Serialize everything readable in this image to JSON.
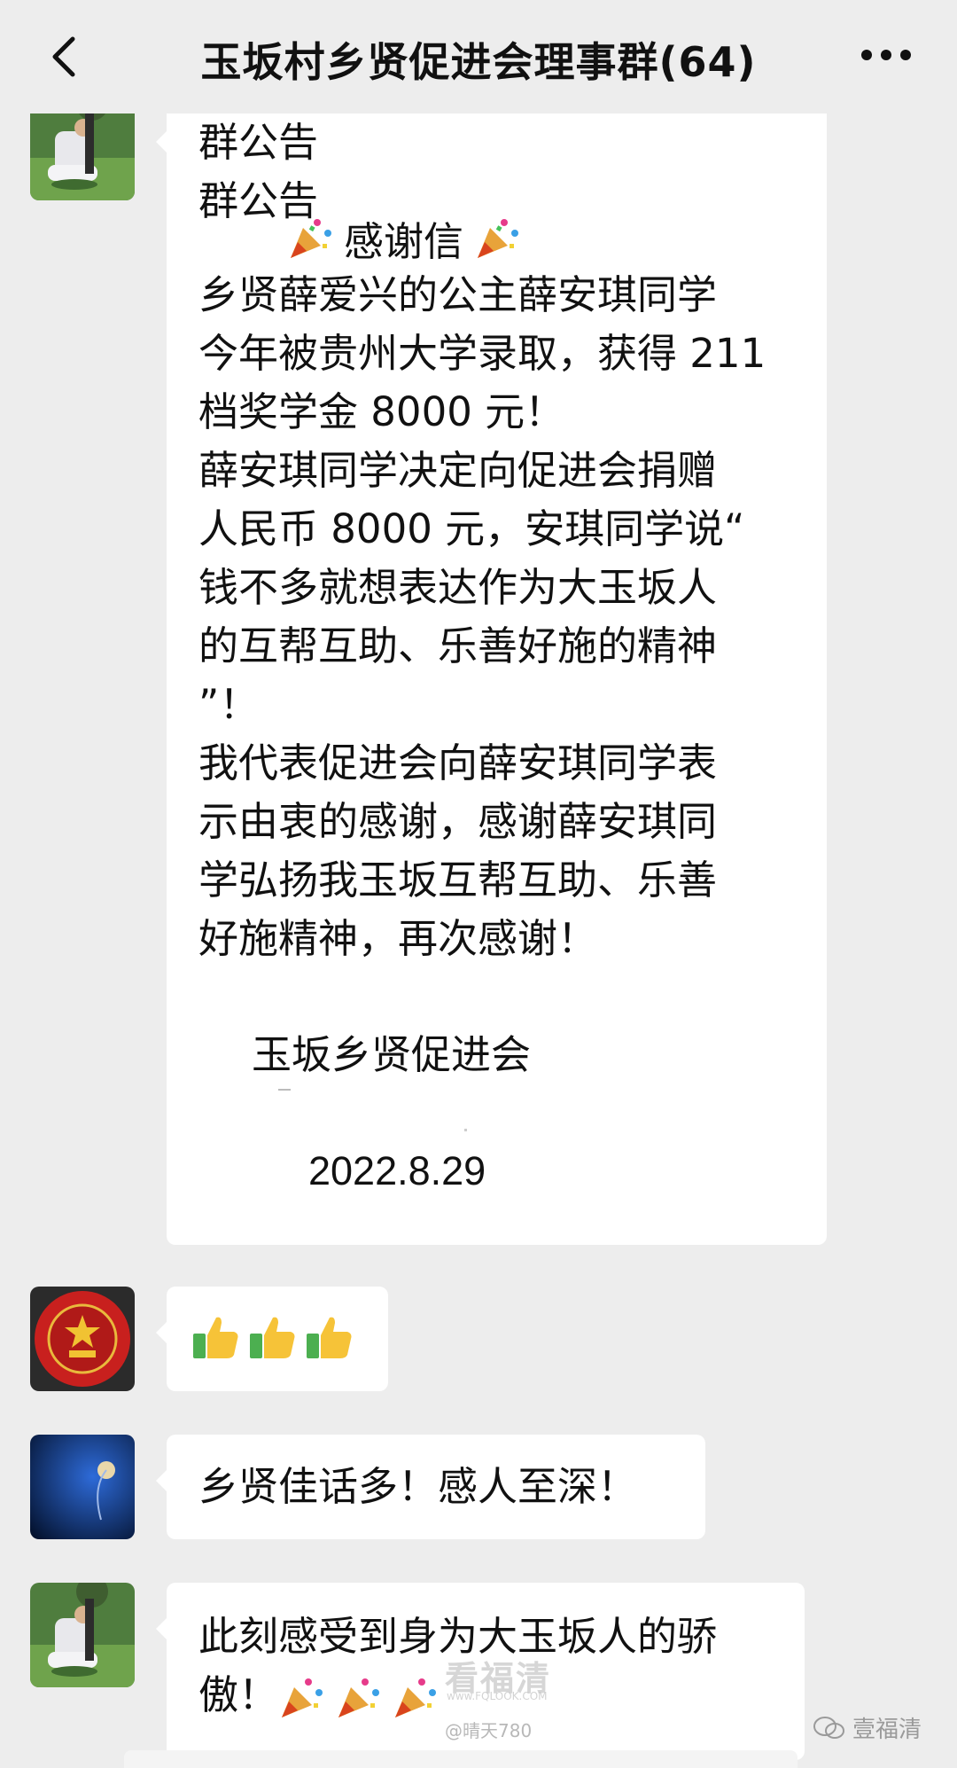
{
  "header": {
    "title": "玉坂村乡贤促进会理事群(64)",
    "back_icon": "chevron-left-icon",
    "more_icon": "more-dots-icon"
  },
  "messages": {
    "notice": {
      "lines_head": "群公告\n群公告",
      "letter_title": "感谢信",
      "body": "乡贤薛爱兴的公主薛安琪同学\n今年被贵州大学录取，获得 211\n档奖学金 8000 元！\n薛安琪同学决定向促进会捐赠\n人民币 8000 元，安琪同学说“\n钱不多就想表达作为大玉坂人\n的互帮互助、乐善好施的精神\n”！\n我代表促进会向薛安琪同学表\n示由衷的感谢，感谢薛安琪同\n学弘扬我玉坂互帮互助、乐善\n好施精神，再次感谢！",
      "org": "玉坂乡贤促进会",
      "date": "2022.8.29"
    },
    "thumbs": {
      "emoji": "thumbs-up-icon"
    },
    "msg3": {
      "text": "乡贤佳话多！感人至深！"
    },
    "msg4": {
      "text": "此刻感受到身为大玉坂人的骄\n傲！"
    }
  },
  "watermarks": {
    "site": "看福清",
    "site_url": "www.FQLOOK.COM",
    "user": "@晴天780",
    "account": "壹福清"
  },
  "colors": {
    "background": "#ededed",
    "bubble": "#ffffff",
    "text": "#111111"
  }
}
